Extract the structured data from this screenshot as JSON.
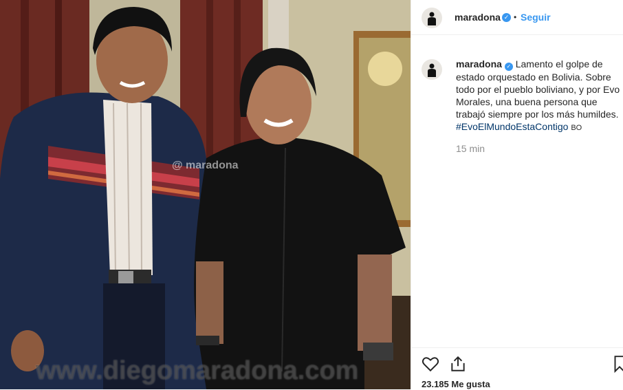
{
  "post": {
    "username": "maradona",
    "verified_icon": "verified-badge-icon",
    "separator": "•",
    "follow_label": "Seguir",
    "caption_text": "Lamento el golpe de estado orquestado en Bolivia. Sobre todo por el pueblo boliviano, y por Evo Morales, una buena persona que trabajó siempre por los más humildes.",
    "hashtag": "#EvoElMundoEstaContigo",
    "hashtag_suffix": "BO",
    "time_ago": "15 min",
    "likes": "23.185 Me gusta"
  },
  "photo": {
    "watermark_small": "@ maradona",
    "watermark_large": "www.diegomaradona.com"
  },
  "icons": {
    "like": "heart-icon",
    "share": "share-icon",
    "save": "bookmark-icon"
  },
  "colors": {
    "accent": "#3897f0",
    "text": "#262626",
    "muted": "#8e8e8e",
    "hashtag": "#003569"
  }
}
